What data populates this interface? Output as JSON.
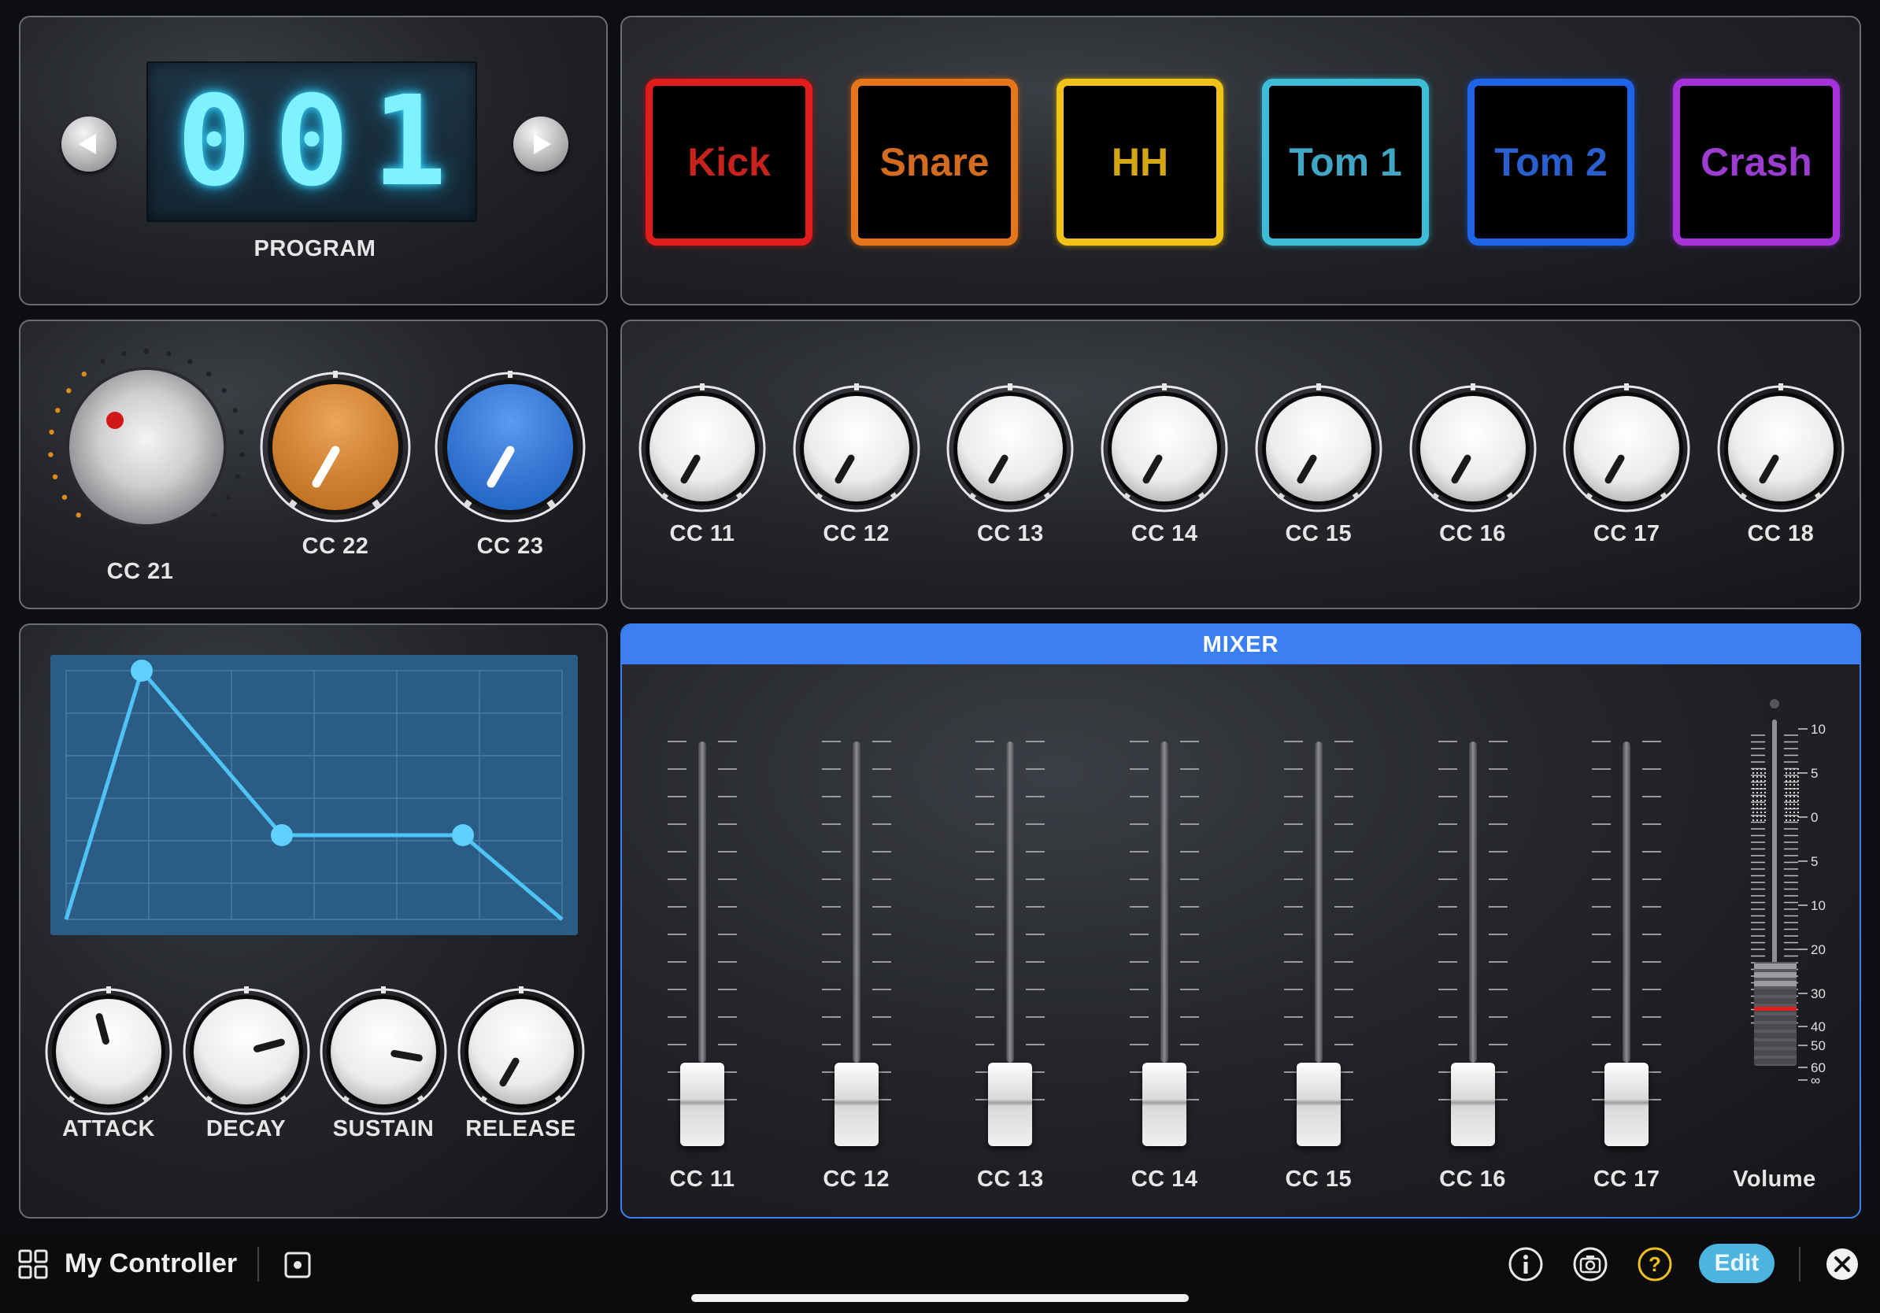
{
  "program": {
    "value_digits": [
      "0",
      "0",
      "1"
    ],
    "label": "PROGRAM"
  },
  "pads": [
    {
      "label": "Kick",
      "color": "#e11c1c",
      "text_color": "#c8221f"
    },
    {
      "label": "Snare",
      "color": "#e6761c",
      "text_color": "#d46c1f"
    },
    {
      "label": "HH",
      "color": "#f0c318",
      "text_color": "#d4a712"
    },
    {
      "label": "Tom 1",
      "color": "#3fbcd6",
      "text_color": "#3fa7c4"
    },
    {
      "label": "Tom 2",
      "color": "#1f64e6",
      "text_color": "#2a5fd0"
    },
    {
      "label": "Crash",
      "color": "#a632d9",
      "text_color": "#9c3cd0"
    }
  ],
  "knobs_left": [
    {
      "label": "CC 21"
    },
    {
      "label": "CC 22",
      "color": "#ea8c2a"
    },
    {
      "label": "CC 23",
      "color": "#2d7ef0"
    }
  ],
  "knobs_row": [
    "CC 11",
    "CC 12",
    "CC 13",
    "CC 14",
    "CC 15",
    "CC 16",
    "CC 17",
    "CC 18"
  ],
  "envelope": {
    "knobs": [
      "ATTACK",
      "DECAY",
      "SUSTAIN",
      "RELEASE"
    ]
  },
  "mixer": {
    "title": "MIXER",
    "faders": [
      "CC 11",
      "CC 12",
      "CC 13",
      "CC 14",
      "CC 15",
      "CC 16",
      "CC 17"
    ],
    "volume": {
      "label": "Volume",
      "scale": [
        "10",
        "5",
        "0",
        "5",
        "10",
        "20",
        "30",
        "40",
        "50",
        "60",
        "∞"
      ]
    }
  },
  "bottom_bar": {
    "title": "My Controller",
    "edit_label": "Edit",
    "icons": [
      "grid-icon",
      "square-dot-icon",
      "info-icon",
      "camera-icon",
      "help-icon",
      "close-icon"
    ]
  }
}
